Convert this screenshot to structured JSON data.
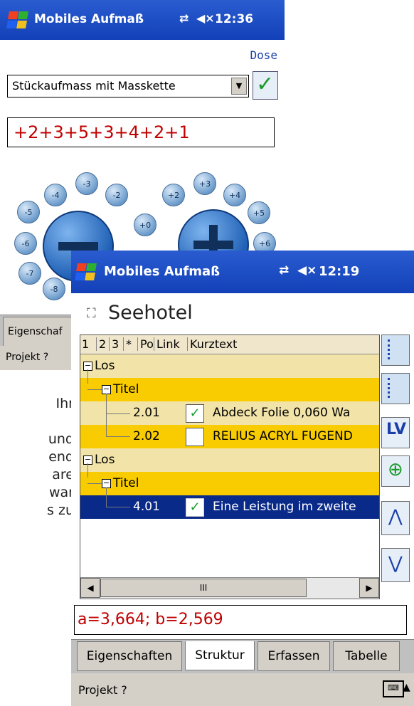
{
  "back_window": {
    "title": "Mobiles Aufmaß",
    "time": "12:36",
    "link": "Dose",
    "select_value": "Stückaufmass mit Masskette",
    "formula": "+2+3+5+3+4+2+1",
    "minus_buttons": [
      "-4",
      "-3",
      "-2",
      "-5",
      "-6",
      "-7",
      "-8"
    ],
    "plus_buttons": [
      "+2",
      "+3",
      "+4",
      "+5",
      "+6",
      "+0"
    ],
    "tab_partial": "Eigenschaf",
    "menu": "Projekt ?"
  },
  "article_text": [
    "Ihr",
    "und",
    "end",
    "are",
    "war",
    "s zu"
  ],
  "front_window": {
    "title": "Mobiles Aufmaß",
    "time": "12:19",
    "project_title": "Seehotel",
    "columns": [
      "1",
      "2",
      "3",
      "*",
      "Po",
      "Link",
      "Kurztext"
    ],
    "rows": [
      {
        "type": "group",
        "label": "Los"
      },
      {
        "type": "subgroup",
        "label": "Titel"
      },
      {
        "type": "item",
        "pos": "2.01",
        "checked": true,
        "text": "Abdeck Folie 0,060 Wa"
      },
      {
        "type": "item",
        "pos": "2.02",
        "checked": false,
        "text": "RELIUS ACRYL FUGEND"
      },
      {
        "type": "group",
        "label": "Los"
      },
      {
        "type": "subgroup",
        "label": "Titel"
      },
      {
        "type": "item-selected",
        "pos": "4.01",
        "checked": true,
        "text": "Eine Leistung im zweite"
      }
    ],
    "scroll_mark": "III",
    "result": "a=3,664; b=2,569",
    "tabs": [
      "Eigenschaften",
      "Struktur",
      "Erfassen",
      "Tabelle"
    ],
    "menu": "Projekt ?",
    "side_buttons": [
      "list-view",
      "details",
      "LV",
      "add-link",
      "up",
      "down"
    ],
    "colors": {
      "accent": "#1240b8",
      "row_yellow": "#f8d000",
      "row_light": "#f0e0a0",
      "selected": "#0a2a8a",
      "formula_red": "#c00000"
    }
  }
}
